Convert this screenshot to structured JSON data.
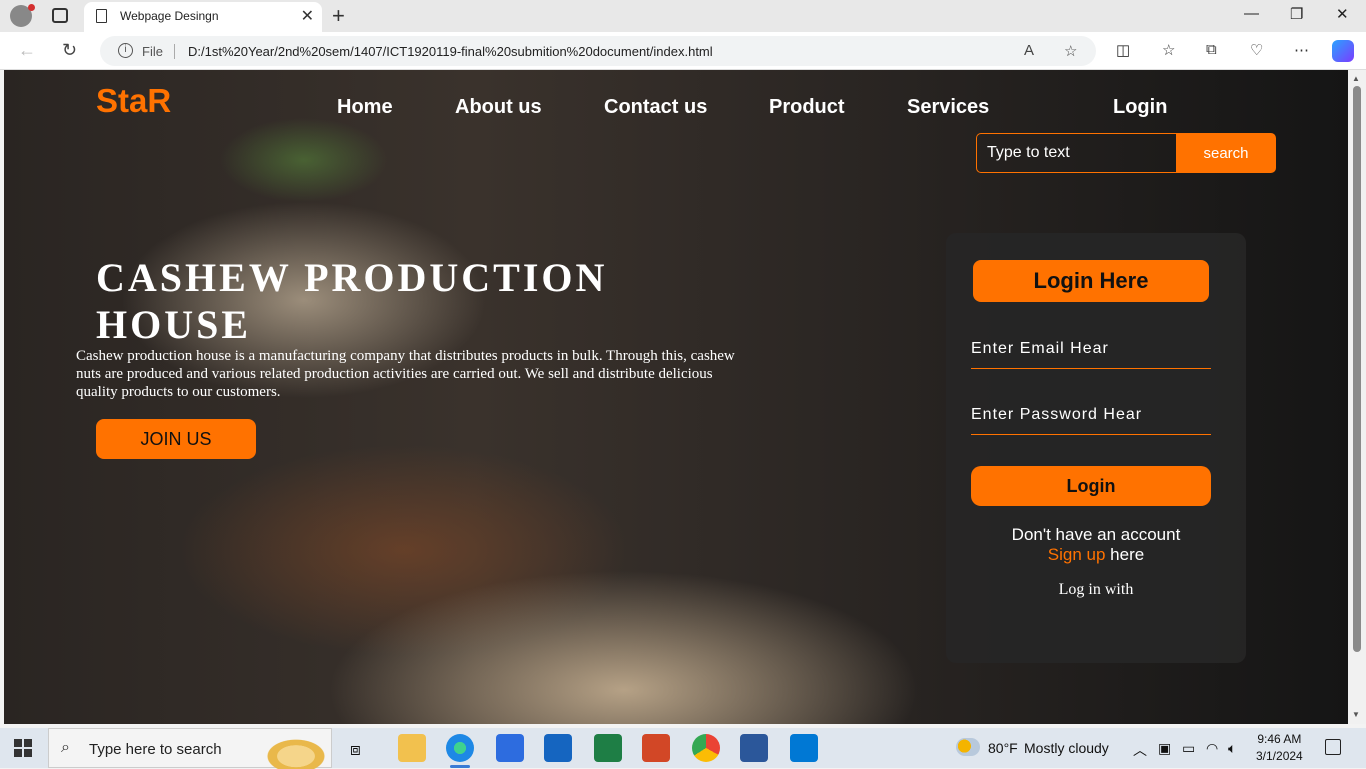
{
  "browser": {
    "tab_title": "Webpage Desingn",
    "file_label": "File",
    "url": "D:/1st%20Year/2nd%20sem/1407/ICT1920119-final%20submition%20document/index.html"
  },
  "site": {
    "logo": "StaR",
    "nav": [
      "Home",
      "About us",
      "Contact us",
      "Product",
      "Services",
      "Login"
    ],
    "search": {
      "placeholder": "Type to text",
      "button": "search"
    },
    "hero": {
      "title": "CASHEW PRODUCTION HOUSE",
      "description": "Cashew production house is a manufacturing company that distributes products in bulk. Through this, cashew nuts are produced and various related production activities are carried out. We sell and distribute delicious quality products to our customers.",
      "join_label": "JOIN US"
    },
    "login": {
      "heading": "Login Here",
      "email_placeholder": "Enter Email Hear",
      "password_placeholder": "Enter Password Hear",
      "button": "Login",
      "no_account": "Don't have an account",
      "signup_link": "Sign up",
      "signup_suffix": " here",
      "log_in_with": "Log in with"
    },
    "accent_color": "#ff7200"
  },
  "taskbar": {
    "search_placeholder": "Type here to search",
    "weather_temp": "80°F",
    "weather_desc": "Mostly cloudy",
    "time": "9:46 AM",
    "date": "3/1/2024"
  }
}
